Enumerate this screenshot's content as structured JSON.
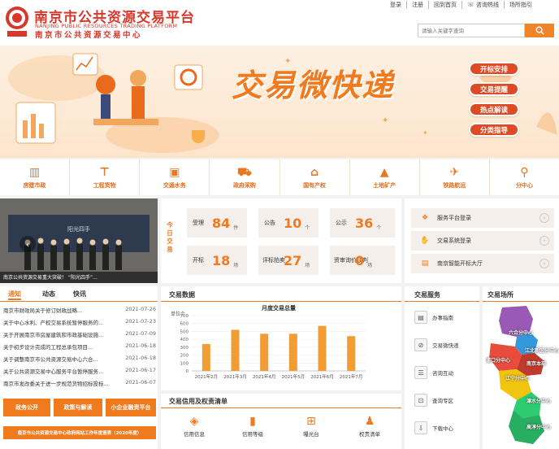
{
  "header": {
    "title_cn": "南京市公共资源交易平台",
    "title_en": "NANJING PUBLIC RESOURCES TRADING PLATFORM",
    "title_center": "南京市公共资源交易中心",
    "links": [
      "登录",
      "注册",
      "回到首页",
      "咨询热线",
      "场所指引"
    ],
    "search_placeholder": "请输入关键字查询"
  },
  "banner": {
    "title": "交易微快递",
    "pills": [
      "开标安排",
      "交易提醒",
      "热点解读",
      "分类指导"
    ]
  },
  "categories": [
    {
      "label": "房建市政",
      "icon": "building-icon"
    },
    {
      "label": "工程货物",
      "icon": "crane-icon"
    },
    {
      "label": "交通水务",
      "icon": "bus-icon"
    },
    {
      "label": "政府采购",
      "icon": "cart-icon"
    },
    {
      "label": "国有产权",
      "icon": "bank-icon"
    },
    {
      "label": "土地矿产",
      "icon": "mountain-icon"
    },
    {
      "label": "铁路航运",
      "icon": "plane-icon"
    },
    {
      "label": "分中心",
      "icon": "pin-icon"
    }
  ],
  "slideshow": {
    "caption": "南京公共资源交易重大突破！  “阳光四手”...",
    "banner_text": "阳光四手"
  },
  "today": {
    "label": "今日交易",
    "cells": [
      {
        "label": "受理",
        "value": "84",
        "unit": "件"
      },
      {
        "label": "公告",
        "value": "10",
        "unit": "个"
      },
      {
        "label": "公示",
        "value": "36",
        "unit": "个"
      },
      {
        "label": "开标",
        "value": "18",
        "unit": "场"
      },
      {
        "label": "评标拍卖",
        "value": "27",
        "unit": "场"
      },
      {
        "label": "资审询价谈判",
        "value": "0",
        "unit": "场"
      }
    ]
  },
  "quick_services": [
    {
      "label": "服务平台登录",
      "icon": "grid-icon"
    },
    {
      "label": "交易系统登录",
      "icon": "handshake-icon"
    },
    {
      "label": "南京智能开标大厅",
      "icon": "hall-icon"
    }
  ],
  "notices": {
    "tabs": [
      "通知",
      "动态",
      "快讯"
    ],
    "items": [
      {
        "title": "南京市财政局关于修订财政战略...",
        "date": "2021-07-26"
      },
      {
        "title": "关于中心水利、产权交易系统暂停服务的...",
        "date": "2021-07-23"
      },
      {
        "title": "关于开展南京市房屋建筑和市政基础设施...",
        "date": "2021-07-09"
      },
      {
        "title": "关于初步设计完成的工程总承包项目...",
        "date": "2021-06-18"
      },
      {
        "title": "关于调整南京市公共资源交易中心六合...",
        "date": "2021-06-18"
      },
      {
        "title": "关于公共资源交易中心服务平台暂停服务...",
        "date": "2021-06-17"
      },
      {
        "title": "南京市发改委关于进一步规范货物招标投标...",
        "date": "2021-06-07"
      }
    ],
    "buttons": [
      "政务公开",
      "政策与解读",
      "小企业融资平台"
    ],
    "report": "南京市公共资源交易中心政府网站工作年度报表（2020年度）"
  },
  "trade_data": {
    "title": "交易数据"
  },
  "chart_data": {
    "type": "bar",
    "title": "月度交易总量",
    "ylabel": "单位个",
    "categories": [
      "2021年2月",
      "2021年3月",
      "2021年4月",
      "2021年5月",
      "2021年6月",
      "2021年7月"
    ],
    "values": [
      340,
      520,
      470,
      470,
      570,
      440
    ],
    "yticks": [
      "0",
      "100",
      "200",
      "300",
      "400",
      "500",
      "600",
      "700"
    ],
    "ylim": [
      0,
      700
    ],
    "color": "#f29d33"
  },
  "credit": {
    "title": "交易信用及权责清单",
    "items": [
      {
        "label": "信用信息",
        "icon": "layers-icon"
      },
      {
        "label": "信用等级",
        "icon": "bar-chart-icon"
      },
      {
        "label": "曝光台",
        "icon": "board-icon"
      },
      {
        "label": "权责清单",
        "icon": "people-icon"
      }
    ]
  },
  "trade_service": {
    "title": "交易服务",
    "items": [
      {
        "label": "办事指南",
        "icon": "book-icon"
      },
      {
        "label": "交易微快递",
        "icon": "compass-icon"
      },
      {
        "label": "咨询互动",
        "icon": "chat-icon"
      },
      {
        "label": "查询专区",
        "icon": "search-doc-icon"
      },
      {
        "label": "下载中心",
        "icon": "download-icon"
      }
    ]
  },
  "venue": {
    "title": "交易场所",
    "labels": [
      "六合分中心",
      "江北新区分中心",
      "浦口分中心",
      "南京本部",
      "江宁分中心",
      "溧水分中心",
      "高淳分中心"
    ]
  }
}
